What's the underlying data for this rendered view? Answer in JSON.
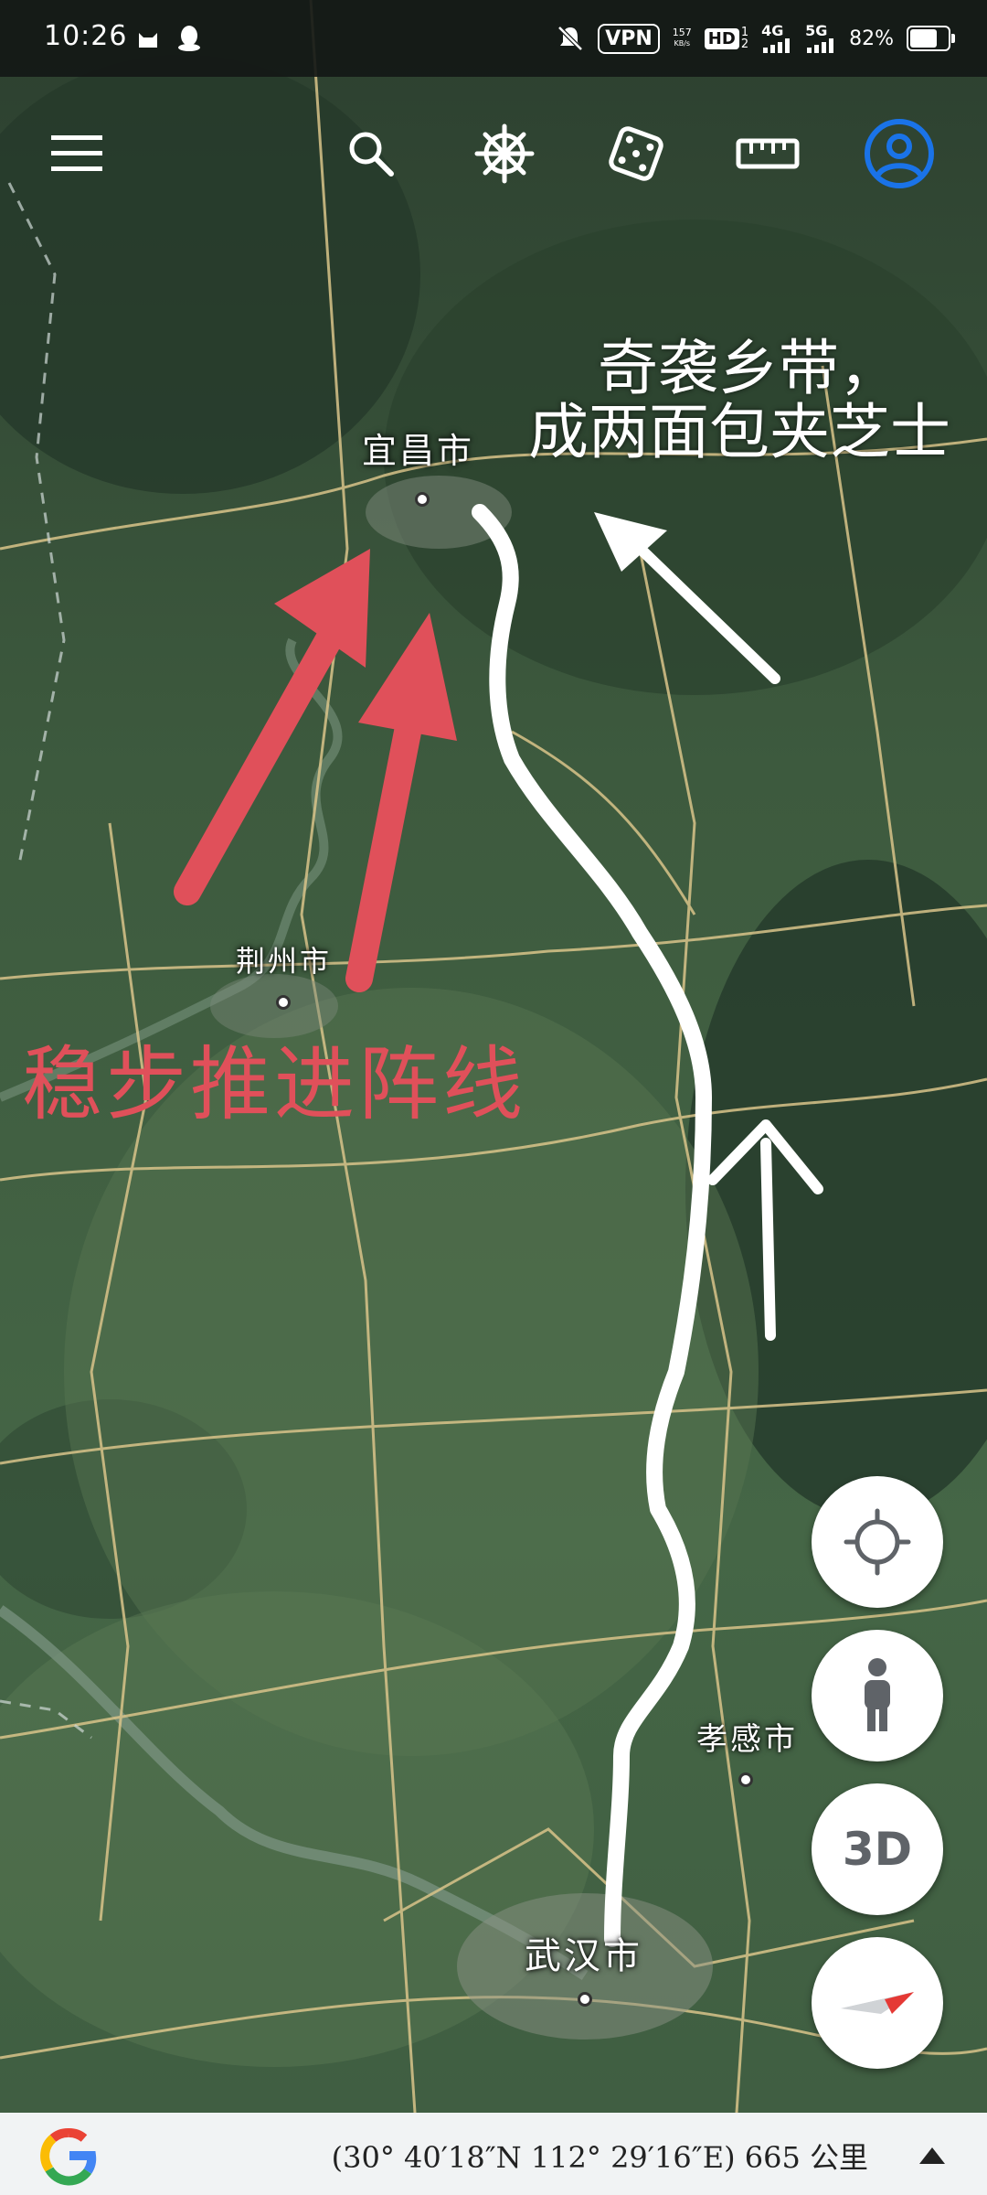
{
  "status_bar": {
    "time": "10:26",
    "net_speed_value": "157",
    "net_speed_unit": "KB/s",
    "vpn": "VPN",
    "hd": "HD",
    "sim1": "1",
    "sim2": "2",
    "net_4g": "4G",
    "net_5g": "5G",
    "battery": "82%",
    "battery_level": 0.82
  },
  "toolbar": {
    "icons": [
      "menu-icon",
      "search-icon",
      "ship-wheel-icon",
      "dice-icon",
      "ruler-icon",
      "account-icon"
    ],
    "accent": "#1a73e8"
  },
  "map": {
    "cities": {
      "yichang": "宜昌市",
      "jingzhou": "荆州市",
      "xiaogan": "孝感市",
      "wuhan": "武汉市"
    }
  },
  "annotations": {
    "white_line1": "奇袭乡带，",
    "white_line2": "成两面包夹芝士",
    "red_text": "稳步推进阵线",
    "red_color": "#e0505a"
  },
  "controls": {
    "locate": "crosshair-icon",
    "pegman": "pegman-icon",
    "three_d": "3D",
    "compass": "compass-icon"
  },
  "bottom_bar": {
    "logo": "google-logo",
    "coordinates": "(30° 40′18″N 112° 29′16″E) 665 公里"
  }
}
